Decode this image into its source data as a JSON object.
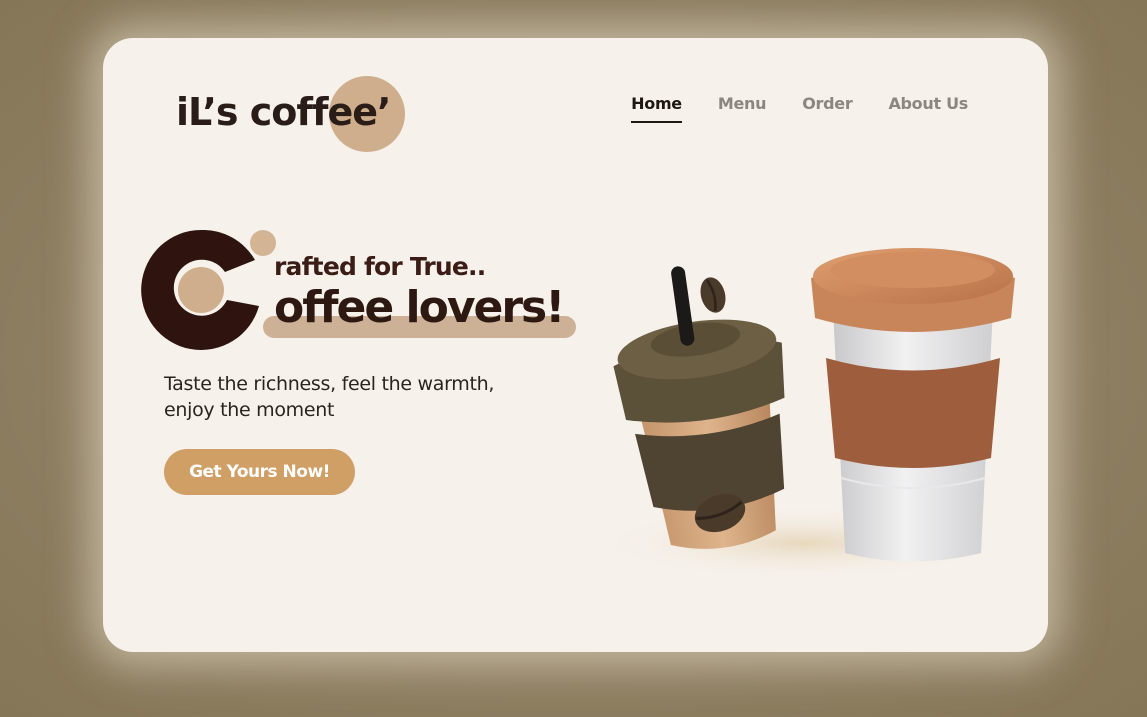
{
  "logo": {
    "text": "iL’s coffee’"
  },
  "nav": {
    "items": [
      {
        "label": "Home",
        "active": true
      },
      {
        "label": "Menu",
        "active": false
      },
      {
        "label": "Order",
        "active": false
      },
      {
        "label": "About Us",
        "active": false
      }
    ]
  },
  "hero": {
    "line1": "rafted for True..",
    "line2": "offee lovers!",
    "tagline_line1": "Taste the richness, feel the warmth,",
    "tagline_line2": "enjoy the moment",
    "cta_label": "Get Yours Now!"
  },
  "colors": {
    "page_background": "#8a7b60",
    "card_background": "#f6f1eb",
    "accent_brown_dark": "#3b1d16",
    "accent_tan": "#cfae8d",
    "cta_background": "#cf9f66",
    "nav_active": "#1e1714",
    "nav_inactive": "#8b8680"
  },
  "icons": {
    "big_letter": "letter-c-circle-icon",
    "beans": "coffee-bean-icon",
    "cups": "coffee-cup-illustration"
  }
}
